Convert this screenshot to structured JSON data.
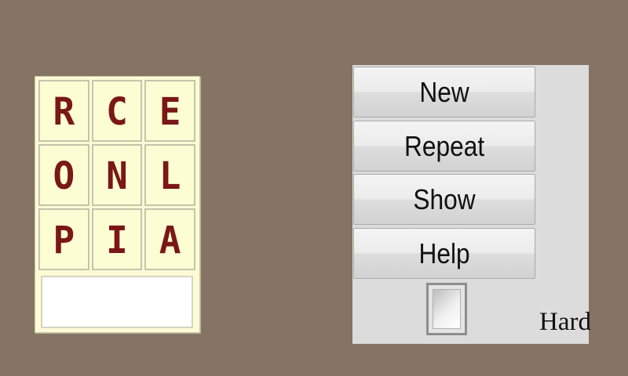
{
  "board": {
    "tiles": [
      [
        "R",
        "C",
        "E"
      ],
      [
        "O",
        "N",
        "L"
      ],
      [
        "P",
        "I",
        "A"
      ]
    ],
    "answer_value": ""
  },
  "controls": {
    "new_label": "New",
    "repeat_label": "Repeat",
    "show_label": "Show",
    "help_label": "Help",
    "hard_label": "Hard",
    "hard_checked": false
  },
  "colors": {
    "background": "#857464",
    "tile_fill": "#fdfdd3",
    "letter": "#7a1717",
    "panel": "#dcdcdc"
  }
}
